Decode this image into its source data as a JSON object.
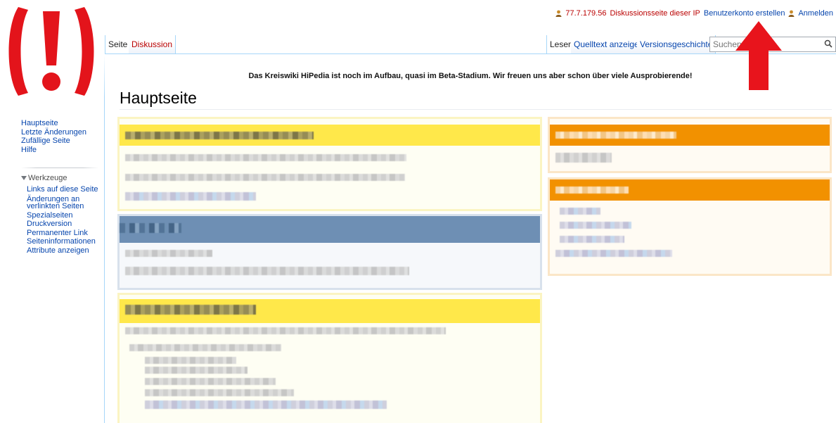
{
  "personal_tools": {
    "ip": "77.7.179.56",
    "talk": "Diskussionsseite dieser IP",
    "create_account": "Benutzerkonto erstellen",
    "login": "Anmelden"
  },
  "tabs": {
    "page": "Seite",
    "discussion": "Diskussion",
    "read": "Lesen",
    "view_source": "Quelltext anzeigen",
    "history": "Versionsgeschichte"
  },
  "search": {
    "placeholder": "Suchen"
  },
  "sitenotice": "Das Kreiswiki HiPedia ist noch im Aufbau, quasi im Beta-Stadium. Wir freuen uns aber schon über viele Ausprobierende!",
  "page_title": "Hauptseite",
  "nav": {
    "main": [
      "Hauptseite",
      "Letzte Änderungen",
      "Zufällige Seite",
      "Hilfe"
    ],
    "tools_heading": "Werkzeuge",
    "tools": [
      "Links auf diese Seite",
      "Änderungen an verlinkten Seiten",
      "Spezialseiten",
      "Druckversion",
      "Permanenter Link",
      "Seiteninformationen",
      "Attribute anzeigen"
    ]
  },
  "colors": {
    "logo_red": "#e3141b",
    "arrow_red": "#e8141c",
    "box_yellow": "#ffe84a",
    "box_yellow_bg": "#fefef3",
    "box_orange": "#f29100",
    "box_orange_bg": "#fffbf3",
    "box_blue": "#6e8fb4",
    "box_blue_bg": "#f6f8fb",
    "link": "#0645ad"
  },
  "icons": [
    "logo-alert-icon",
    "user-icon",
    "search-icon",
    "triangle-down-icon",
    "red-arrow-icon"
  ]
}
